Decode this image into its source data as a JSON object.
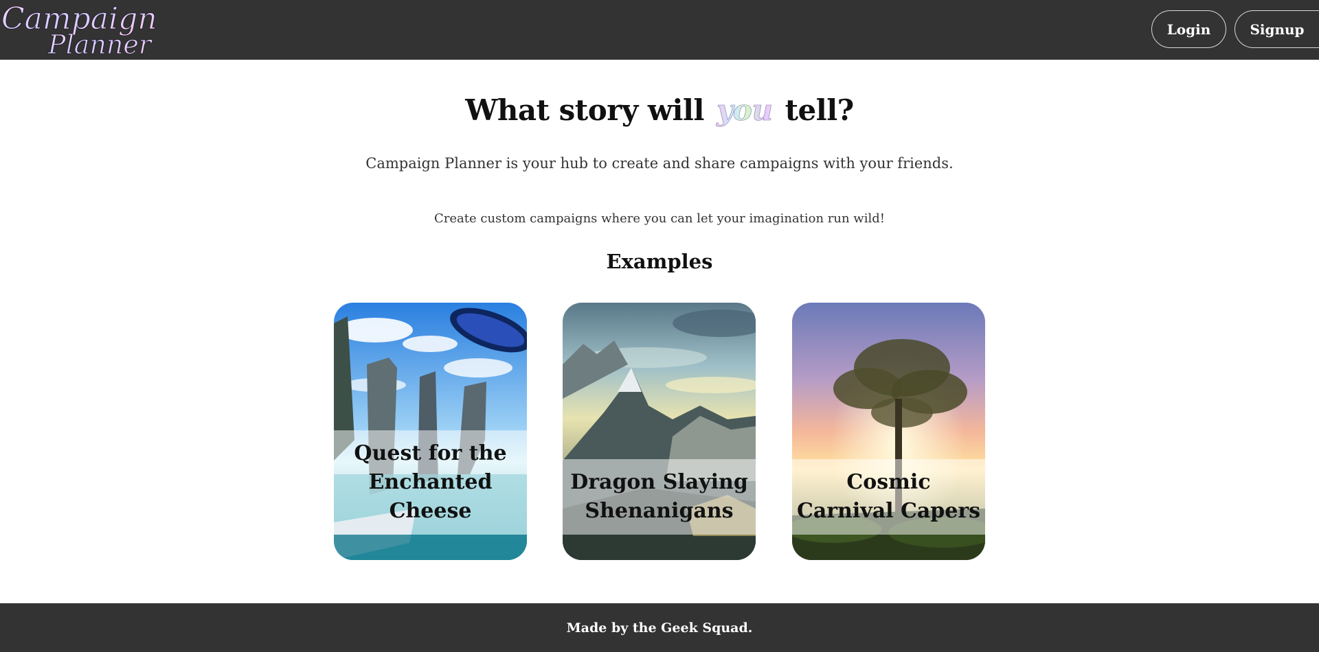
{
  "header": {
    "logo": {
      "line1": "Campaign",
      "line2": "Planner"
    },
    "login_label": "Login",
    "signup_label": "Signup"
  },
  "hero": {
    "headline_before": "What story will",
    "headline_emphasis": "you",
    "headline_after": "tell?",
    "tagline": "Campaign Planner is your hub to create and share campaigns with your friends.",
    "subtag": "Create custom campaigns where you can let your imagination run wild!"
  },
  "examples": {
    "title": "Examples",
    "cards": [
      {
        "title": "Quest for the Enchanted Cheese"
      },
      {
        "title": "Dragon Slaying Shenanigans"
      },
      {
        "title": "Cosmic Carnival Capers"
      }
    ]
  },
  "footer": {
    "text": "Made by the Geek Squad."
  },
  "colors": {
    "header_bg": "#333333",
    "footer_bg": "#333333",
    "page_bg": "#ffffff"
  }
}
